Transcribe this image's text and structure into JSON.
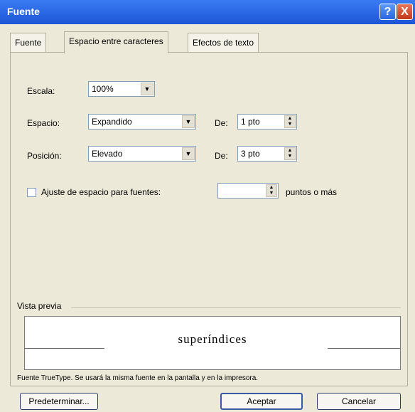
{
  "window": {
    "title": "Fuente"
  },
  "title_buttons": {
    "help": "?",
    "close": "X"
  },
  "tabs": [
    {
      "label": "Fuente"
    },
    {
      "label": "Espacio entre caracteres"
    },
    {
      "label": "Efectos de texto"
    }
  ],
  "fields": {
    "escala": {
      "label": "Escala:",
      "value": "100%"
    },
    "espacio": {
      "label": "Espacio:",
      "value": "Expandido",
      "de_label": "De:",
      "de_value": "1 pto"
    },
    "posicion": {
      "label": "Posición:",
      "value": "Elevado",
      "de_label": "De:",
      "de_value": "3 pto"
    },
    "kerning": {
      "label": "Ajuste de espacio para fuentes:",
      "value": "",
      "suffix": "puntos o más",
      "checked": false
    }
  },
  "preview": {
    "label": "Vista previa",
    "sample": "superíndices",
    "footnote": "Fuente TrueType. Se usará la misma fuente en la pantalla y en la impresora."
  },
  "buttons": {
    "default": "Predeterminar...",
    "ok": "Aceptar",
    "cancel": "Cancelar"
  }
}
